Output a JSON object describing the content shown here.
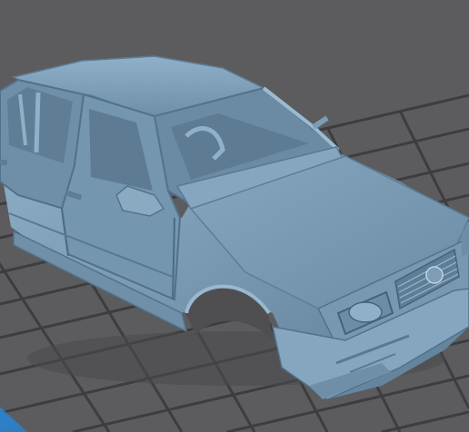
{
  "viewport": {
    "background_color": "#5c5c5e",
    "grid_line_color": "#3d3d3f",
    "plate_edge_color": "#2e7fc6",
    "model_color": "#7a9bb6",
    "model_shadow_color": "#4d6a82",
    "model_highlight_color": "#a3bfd4"
  }
}
